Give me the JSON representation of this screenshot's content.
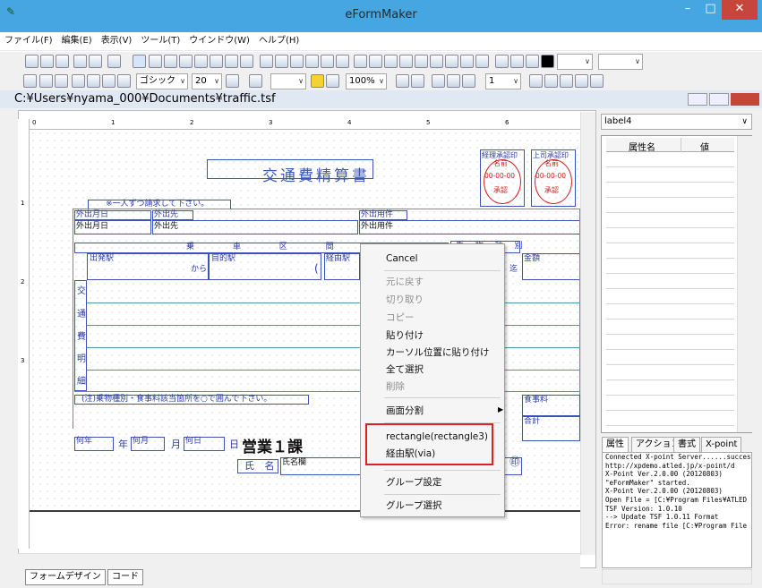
{
  "window": {
    "title": "eFormMaker",
    "minimize": "–",
    "maximize": "□",
    "close": "✕"
  },
  "menu": [
    "ファイル(F)",
    "編集(E)",
    "表示(V)",
    "ツール(T)",
    "ウインドウ(W)",
    "ヘルプ(H)"
  ],
  "toolbar2": {
    "font": "ゴシック",
    "size": "20",
    "zoom": "100%",
    "page": "1"
  },
  "document": {
    "path": "C:¥Users¥nyama_000¥Documents¥traffic.tsf"
  },
  "ruler": {
    "top": [
      "0",
      "1",
      "2",
      "3",
      "4",
      "5",
      "6"
    ],
    "left": [
      "1",
      "2",
      "3"
    ]
  },
  "form": {
    "title": "交通費精算書",
    "stamp1_title": "経理承認印",
    "stamp1_name": "名前",
    "stamp1_date": "00-00-00",
    "stamp1_status": "承認",
    "stamp2_title": "上司承認印",
    "stamp2_name": "名前",
    "stamp2_date": "00-00-00",
    "stamp2_status": "承認",
    "note1": "※一人ずつ請求して下さい。",
    "date_label": "外出月日",
    "date_field": "外出月日",
    "dest_label": "外出先",
    "dest_field": "外出先",
    "purpose_label": "外出用件",
    "purpose_field": "外出用件",
    "section_header": "乗 車 区 間",
    "fare_header": "乗 物 種 別",
    "from_label": "出発駅",
    "kara": "から",
    "to_label": "目的駅",
    "via_label": "経由駅",
    "amount_label": "金額",
    "paren": "(",
    "made": "迄",
    "vertical": [
      "交",
      "通",
      "費",
      "明",
      "細"
    ],
    "note2": "(注)乗物種別・食事料該当箇所を○で囲んで下さい。",
    "meal_label": "食事料",
    "total_label": "合計",
    "year_label": "何年",
    "year_unit": "年",
    "month_label": "何月",
    "month_unit": "月",
    "day_label": "何日",
    "day_unit": "日",
    "dept": "営業１課",
    "name_label": "氏 名",
    "name_field": "氏名欄",
    "seal": "㊞"
  },
  "context_menu": {
    "cancel": "Cancel",
    "undo": "元に戻す",
    "cut": "切り取り",
    "copy": "コピー",
    "paste": "貼り付け",
    "paste_at_cursor": "カーソル位置に貼り付け",
    "select_all": "全て選択",
    "delete": "削除",
    "split": "画面分割",
    "rectangle": "rectangle(rectangle3)",
    "via_item": "経由駅(via)",
    "group_settings": "グループ設定",
    "group_select": "グループ選択"
  },
  "properties": {
    "selected": "label4",
    "col_name": "属性名",
    "col_value": "値"
  },
  "panel_tabs": [
    "属性",
    "アクション",
    "書式",
    "X-point"
  ],
  "log": [
    "Connected X-point Server......succes",
    " http://xpdemo.atled.jp/x-point/d",
    " X-Point Ver.2.0.00 (20120803)",
    "\"eFormMaker\" started.",
    " X-Point Ver.2.0.00 (20120803)",
    "Open File = [C:¥Program Files¥ATLED",
    "TSF Version: 1.0.10",
    " --> Update TSF 1.0.11 Format",
    "Error: rename file [C:¥Program File"
  ],
  "bottom_tabs": [
    "フォームデザイン",
    "コード"
  ]
}
